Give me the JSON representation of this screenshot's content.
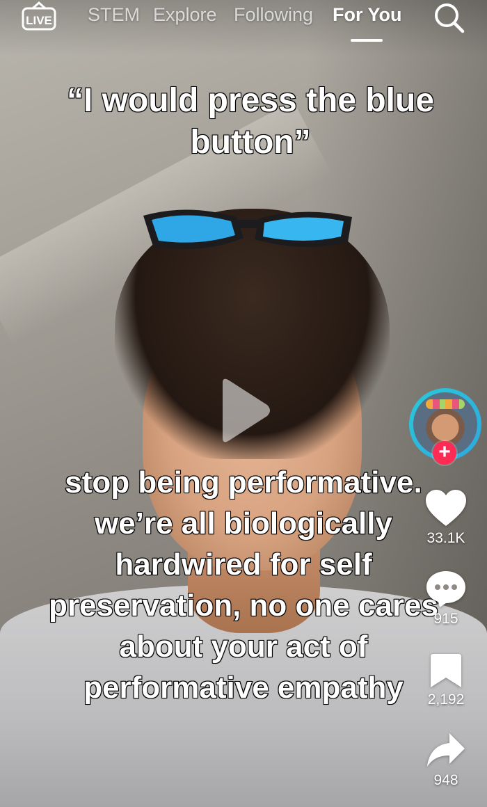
{
  "top_nav": {
    "live_label": "LIVE",
    "tabs": [
      {
        "label": "STEM"
      },
      {
        "label": "Explore"
      },
      {
        "label": "Following"
      },
      {
        "label": "For You",
        "active": true
      }
    ],
    "search_icon": "search-icon"
  },
  "video": {
    "caption_top": "“I would press the blue button”",
    "caption_bottom": "stop being performative. we’re all biologically hardwired for self preservation, no one cares about your act of performative empathy",
    "paused": true
  },
  "actions": {
    "follow_label": "+",
    "like_count": "33.1K",
    "comment_count": "915",
    "save_count": "2,192",
    "share_count": "948"
  },
  "colors": {
    "follow_accent": "#fe2c55",
    "avatar_ring": "#29c9d8",
    "text": "#ffffff"
  }
}
